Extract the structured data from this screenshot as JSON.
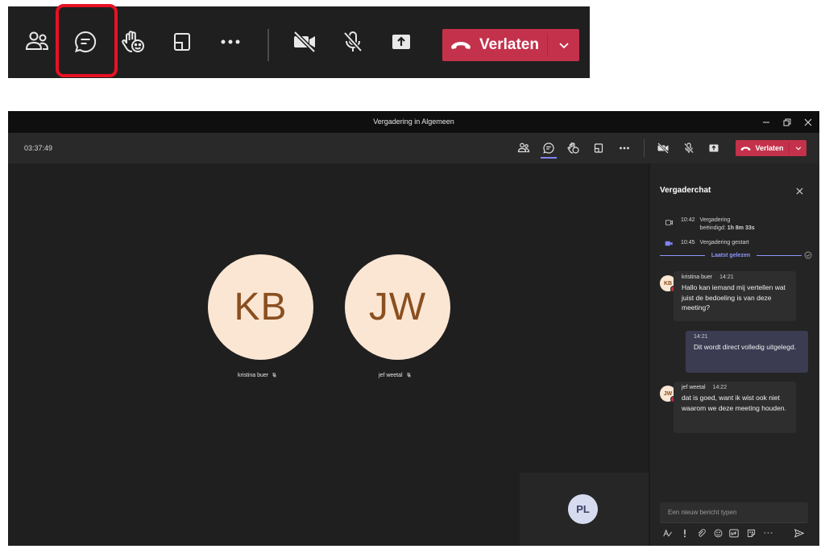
{
  "zoom_toolbar": {
    "leave_label": "Verlaten"
  },
  "window": {
    "title": "Vergadering in Algemeen",
    "timer": "03:37:49",
    "leave_label": "Verlaten"
  },
  "participants": [
    {
      "initials": "KB",
      "name": "kristina buer"
    },
    {
      "initials": "JW",
      "name": "jef weetal"
    }
  ],
  "self_view": {
    "initials": "PL"
  },
  "chat": {
    "title": "Vergaderchat",
    "system_events": [
      {
        "time": "10:42",
        "text_line1": "Vergadering",
        "text_line2_prefix": "beëindigd: ",
        "text_line2_bold": "1h 8m 33s"
      },
      {
        "time": "10:45",
        "text": "Vergadering gestart"
      }
    ],
    "last_read_label": "Laatst gelezen",
    "messages": [
      {
        "initials": "KB",
        "author": "kristina buer",
        "time": "14:21",
        "text": "Hallo kan iemand mij vertellen wat juist de bedoeling is van deze meeting?"
      },
      {
        "time": "14:21",
        "text": "Dit wordt direct volledig uitgelegd."
      },
      {
        "initials": "JW",
        "author": "jef weetal",
        "time": "14:22",
        "text": "dat is goed, want ik wist ook niet waarom we deze meeting houden."
      }
    ],
    "compose_placeholder": "Een nieuw bericht typen"
  },
  "colors": {
    "leave_red": "#c4314b",
    "accent": "#7f85f5",
    "highlight_red": "#e81123",
    "avatar_bg": "#fbe6d4"
  }
}
